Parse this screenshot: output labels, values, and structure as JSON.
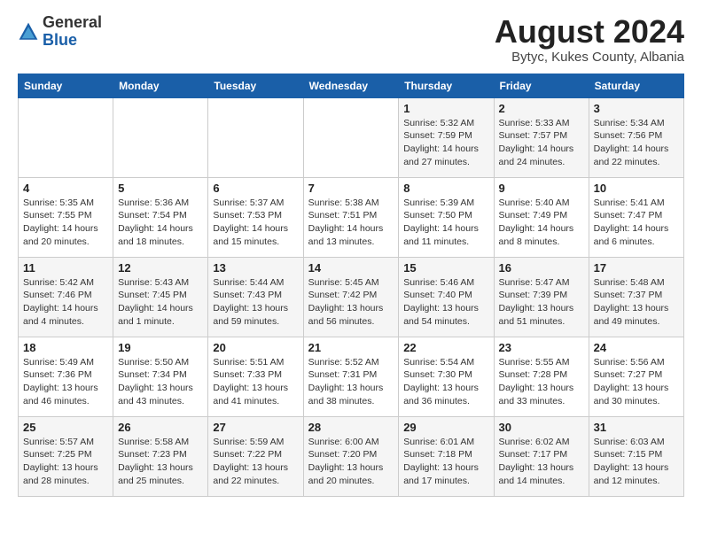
{
  "header": {
    "logo_general": "General",
    "logo_blue": "Blue",
    "month_year": "August 2024",
    "location": "Bytyc, Kukes County, Albania"
  },
  "weekdays": [
    "Sunday",
    "Monday",
    "Tuesday",
    "Wednesday",
    "Thursday",
    "Friday",
    "Saturday"
  ],
  "weeks": [
    [
      {
        "day": "",
        "info": ""
      },
      {
        "day": "",
        "info": ""
      },
      {
        "day": "",
        "info": ""
      },
      {
        "day": "",
        "info": ""
      },
      {
        "day": "1",
        "info": "Sunrise: 5:32 AM\nSunset: 7:59 PM\nDaylight: 14 hours and 27 minutes."
      },
      {
        "day": "2",
        "info": "Sunrise: 5:33 AM\nSunset: 7:57 PM\nDaylight: 14 hours and 24 minutes."
      },
      {
        "day": "3",
        "info": "Sunrise: 5:34 AM\nSunset: 7:56 PM\nDaylight: 14 hours and 22 minutes."
      }
    ],
    [
      {
        "day": "4",
        "info": "Sunrise: 5:35 AM\nSunset: 7:55 PM\nDaylight: 14 hours and 20 minutes."
      },
      {
        "day": "5",
        "info": "Sunrise: 5:36 AM\nSunset: 7:54 PM\nDaylight: 14 hours and 18 minutes."
      },
      {
        "day": "6",
        "info": "Sunrise: 5:37 AM\nSunset: 7:53 PM\nDaylight: 14 hours and 15 minutes."
      },
      {
        "day": "7",
        "info": "Sunrise: 5:38 AM\nSunset: 7:51 PM\nDaylight: 14 hours and 13 minutes."
      },
      {
        "day": "8",
        "info": "Sunrise: 5:39 AM\nSunset: 7:50 PM\nDaylight: 14 hours and 11 minutes."
      },
      {
        "day": "9",
        "info": "Sunrise: 5:40 AM\nSunset: 7:49 PM\nDaylight: 14 hours and 8 minutes."
      },
      {
        "day": "10",
        "info": "Sunrise: 5:41 AM\nSunset: 7:47 PM\nDaylight: 14 hours and 6 minutes."
      }
    ],
    [
      {
        "day": "11",
        "info": "Sunrise: 5:42 AM\nSunset: 7:46 PM\nDaylight: 14 hours and 4 minutes."
      },
      {
        "day": "12",
        "info": "Sunrise: 5:43 AM\nSunset: 7:45 PM\nDaylight: 14 hours and 1 minute."
      },
      {
        "day": "13",
        "info": "Sunrise: 5:44 AM\nSunset: 7:43 PM\nDaylight: 13 hours and 59 minutes."
      },
      {
        "day": "14",
        "info": "Sunrise: 5:45 AM\nSunset: 7:42 PM\nDaylight: 13 hours and 56 minutes."
      },
      {
        "day": "15",
        "info": "Sunrise: 5:46 AM\nSunset: 7:40 PM\nDaylight: 13 hours and 54 minutes."
      },
      {
        "day": "16",
        "info": "Sunrise: 5:47 AM\nSunset: 7:39 PM\nDaylight: 13 hours and 51 minutes."
      },
      {
        "day": "17",
        "info": "Sunrise: 5:48 AM\nSunset: 7:37 PM\nDaylight: 13 hours and 49 minutes."
      }
    ],
    [
      {
        "day": "18",
        "info": "Sunrise: 5:49 AM\nSunset: 7:36 PM\nDaylight: 13 hours and 46 minutes."
      },
      {
        "day": "19",
        "info": "Sunrise: 5:50 AM\nSunset: 7:34 PM\nDaylight: 13 hours and 43 minutes."
      },
      {
        "day": "20",
        "info": "Sunrise: 5:51 AM\nSunset: 7:33 PM\nDaylight: 13 hours and 41 minutes."
      },
      {
        "day": "21",
        "info": "Sunrise: 5:52 AM\nSunset: 7:31 PM\nDaylight: 13 hours and 38 minutes."
      },
      {
        "day": "22",
        "info": "Sunrise: 5:54 AM\nSunset: 7:30 PM\nDaylight: 13 hours and 36 minutes."
      },
      {
        "day": "23",
        "info": "Sunrise: 5:55 AM\nSunset: 7:28 PM\nDaylight: 13 hours and 33 minutes."
      },
      {
        "day": "24",
        "info": "Sunrise: 5:56 AM\nSunset: 7:27 PM\nDaylight: 13 hours and 30 minutes."
      }
    ],
    [
      {
        "day": "25",
        "info": "Sunrise: 5:57 AM\nSunset: 7:25 PM\nDaylight: 13 hours and 28 minutes."
      },
      {
        "day": "26",
        "info": "Sunrise: 5:58 AM\nSunset: 7:23 PM\nDaylight: 13 hours and 25 minutes."
      },
      {
        "day": "27",
        "info": "Sunrise: 5:59 AM\nSunset: 7:22 PM\nDaylight: 13 hours and 22 minutes."
      },
      {
        "day": "28",
        "info": "Sunrise: 6:00 AM\nSunset: 7:20 PM\nDaylight: 13 hours and 20 minutes."
      },
      {
        "day": "29",
        "info": "Sunrise: 6:01 AM\nSunset: 7:18 PM\nDaylight: 13 hours and 17 minutes."
      },
      {
        "day": "30",
        "info": "Sunrise: 6:02 AM\nSunset: 7:17 PM\nDaylight: 13 hours and 14 minutes."
      },
      {
        "day": "31",
        "info": "Sunrise: 6:03 AM\nSunset: 7:15 PM\nDaylight: 13 hours and 12 minutes."
      }
    ]
  ]
}
